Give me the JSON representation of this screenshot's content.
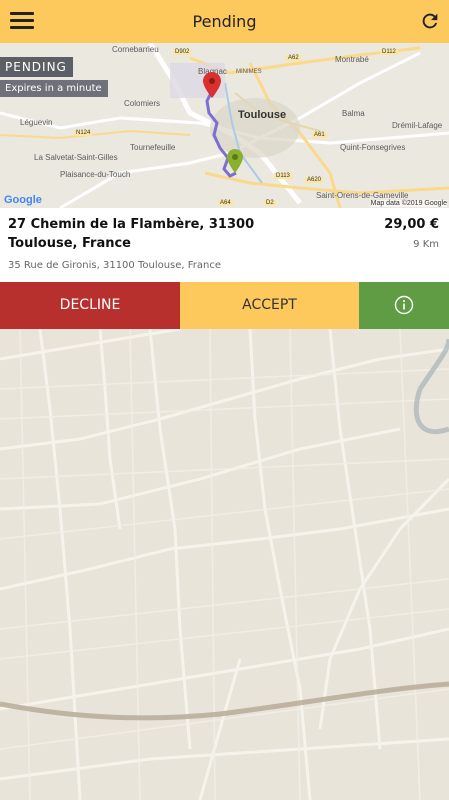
{
  "header": {
    "title": "Pending",
    "menu_icon": "hamburger-menu-icon",
    "refresh_icon": "refresh-icon",
    "background": "#fec95c"
  },
  "minimap": {
    "status_badge": "PENDING",
    "expiry_badge": "Expires in a minute",
    "attribution": "Map data ©2019 Google",
    "logo": "Google",
    "labels": [
      "Cornebarrieu",
      "Montrabé",
      "Blagnac",
      "MINIMES",
      "Colomiers",
      "Toulouse",
      "Balma",
      "Léguevin",
      "Drémil-Lafage",
      "Tournefeuille",
      "Quint-Fonsegrives",
      "La Salvetat-Saint-Gilles",
      "Plaisance-du-Touch",
      "Saint-Orens-de-Gameville"
    ],
    "road_labels": [
      "D902",
      "A62",
      "D112",
      "N124",
      "A61",
      "A620",
      "D113",
      "A64",
      "D2"
    ],
    "pin_start_color": "#d9322e",
    "pin_end_color": "#8ab02e",
    "route_color": "#7b6fd1"
  },
  "ride": {
    "destination": "27 Chemin de la Flambère, 31300 Toulouse, France",
    "origin": "35 Rue de Gironis, 31100 Toulouse, France",
    "price": "29,00 €",
    "distance": "9 Km"
  },
  "actions": {
    "decline_label": "DECLINE",
    "accept_label": "ACCEPT",
    "info_icon": "info-icon",
    "decline_color": "#b8302e",
    "accept_color": "#fec95c",
    "info_color": "#5f9c44"
  }
}
